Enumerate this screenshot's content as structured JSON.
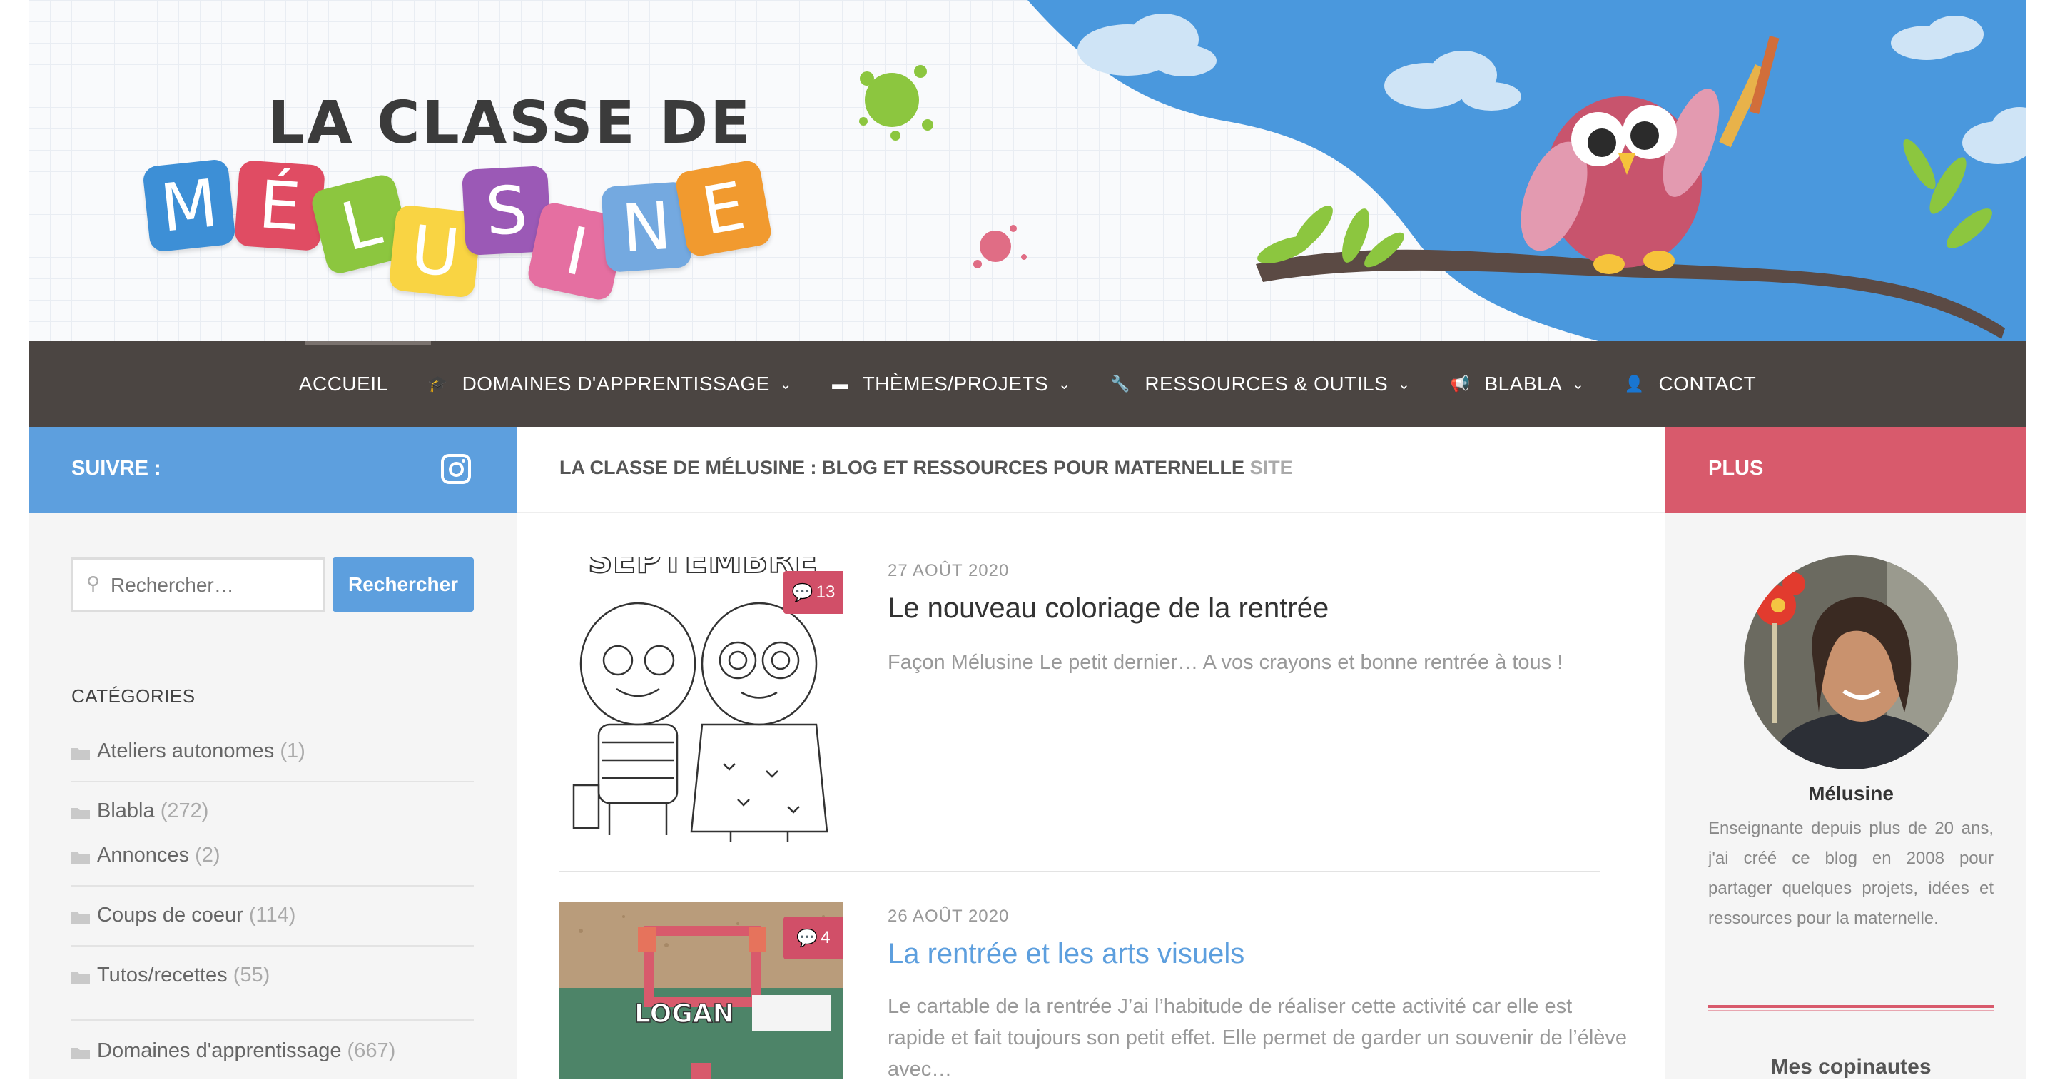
{
  "logo": {
    "top": "LA CLASSE DE",
    "letters": [
      "M",
      "É",
      "L",
      "U",
      "S",
      "I",
      "N",
      "E"
    ],
    "colors": [
      "#3d8fd6",
      "#e04c63",
      "#8cc63f",
      "#f9d443",
      "#9b59b6",
      "#e56fa1",
      "#74a9e0",
      "#f19a2f"
    ]
  },
  "nav": {
    "items": [
      {
        "label": "ACCUEIL",
        "icon": "",
        "name": "nav-accueil",
        "dropdown": false
      },
      {
        "label": "DOMAINES D'APPRENTISSAGE",
        "icon": "🎓",
        "name": "nav-domaines",
        "dropdown": true
      },
      {
        "label": "THÈMES/PROJETS",
        "icon": "▬",
        "name": "nav-themes",
        "dropdown": true
      },
      {
        "label": "RESSOURCES & OUTILS",
        "icon": "🔧",
        "name": "nav-ressources",
        "dropdown": true
      },
      {
        "label": "BLABLA",
        "icon": "📢",
        "name": "nav-blabla",
        "dropdown": true
      },
      {
        "label": "CONTACT",
        "icon": "👤",
        "name": "nav-contact",
        "dropdown": false
      }
    ]
  },
  "left": {
    "follow_title": "SUIVRE :",
    "search": {
      "placeholder": "Rechercher…",
      "button": "Rechercher"
    },
    "categories_title": "CATÉGORIES",
    "categories": [
      {
        "label": "Ateliers autonomes",
        "count": "(1)"
      },
      {
        "label": "Blabla",
        "count": "(272)"
      },
      {
        "label": "Annonces",
        "count": "(2)"
      },
      {
        "label": "Coups de coeur",
        "count": "(114)"
      },
      {
        "label": "Tutos/recettes",
        "count": "(55)"
      },
      {
        "label": "Domaines d'apprentissage",
        "count": "(667)"
      }
    ]
  },
  "center": {
    "breadcrumb": "LA CLASSE DE MÉLUSINE : BLOG ET RESSOURCES POUR MATERNELLE",
    "breadcrumb_suffix": "SITE",
    "posts": [
      {
        "date": "27 AOÛT 2020",
        "title": "Le nouveau coloriage de la rentrée",
        "excerpt": "Façon Mélusine Le petit dernier… A vos crayons et bonne rentrée à tous !",
        "comments": "13",
        "thumb_text": "SEPTEMBRE"
      },
      {
        "date": "26 AOÛT 2020",
        "title": "La rentrée et les arts visuels",
        "excerpt": "Le cartable de la rentrée J’ai l’habitude de réaliser cette activité car elle est rapide et fait toujours son petit effet. Elle permet de garder un souvenir de l’élève avec…",
        "comments": "4",
        "thumb_text": "LOGAN"
      }
    ]
  },
  "right": {
    "title": "PLUS",
    "author": "Mélusine",
    "bio": "Enseignante depuis plus de 20 ans, j'ai créé ce blog en 2008 pour partager quelques projets, idées et ressources pour la maternelle.",
    "copinautes": "Mes copinautes"
  },
  "colors": {
    "nav_bg": "#4b4542",
    "blue": "#5d9fde",
    "pink": "#d85a6c"
  }
}
